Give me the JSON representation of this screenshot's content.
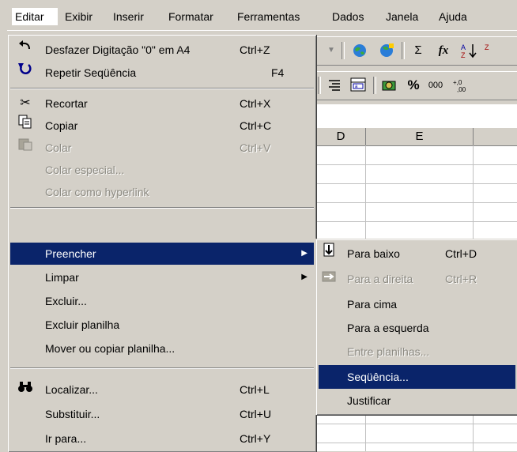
{
  "menubar": {
    "items": [
      "Editar",
      "Exibir",
      "Inserir",
      "Formatar",
      "Ferramentas",
      "Dados",
      "Janela",
      "Ajuda"
    ]
  },
  "toolbar1": {
    "buttons": [
      "Σ",
      "fx"
    ]
  },
  "toolbar2": {
    "buttons": [
      "%",
      "000"
    ]
  },
  "grid": {
    "col_d": "D",
    "col_e": "E"
  },
  "edit_menu": {
    "items": [
      {
        "label": "Desfazer Digitação \"0\" em A4",
        "shortcut": "Ctrl+Z",
        "icon": "undo-icon"
      },
      {
        "label": "Repetir Seqüência",
        "shortcut": "F4",
        "icon": "repeat-icon"
      },
      {
        "label": "Recortar",
        "shortcut": "Ctrl+X",
        "icon": "scissors-icon"
      },
      {
        "label": "Copiar",
        "shortcut": "Ctrl+C",
        "icon": "copy-icon"
      },
      {
        "label": "Colar",
        "shortcut": "Ctrl+V",
        "icon": "paste-icon"
      },
      {
        "label": "Colar especial...",
        "shortcut": ""
      },
      {
        "label": "Colar como hyperlink",
        "shortcut": ""
      },
      {
        "label": "Preencher",
        "shortcut": ""
      },
      {
        "label": "Limpar",
        "shortcut": ""
      },
      {
        "label": "Excluir...",
        "shortcut": ""
      },
      {
        "label": "Excluir planilha",
        "shortcut": ""
      },
      {
        "label": "Mover ou copiar planilha...",
        "shortcut": ""
      },
      {
        "label": "Localizar...",
        "shortcut": "Ctrl+L",
        "icon": "binoculars-icon"
      },
      {
        "label": "Substituir...",
        "shortcut": "Ctrl+U"
      },
      {
        "label": "Ir para...",
        "shortcut": "Ctrl+Y"
      }
    ]
  },
  "fill_submenu": {
    "items": [
      {
        "label": "Para baixo",
        "shortcut": "Ctrl+D",
        "icon": "fill-down-icon"
      },
      {
        "label": "Para a direita",
        "shortcut": "Ctrl+R",
        "icon": "fill-right-icon"
      },
      {
        "label": "Para cima",
        "shortcut": ""
      },
      {
        "label": "Para a esquerda",
        "shortcut": ""
      },
      {
        "label": "Entre planilhas...",
        "shortcut": ""
      },
      {
        "label": "Seqüência...",
        "shortcut": ""
      },
      {
        "label": "Justificar",
        "shortcut": ""
      }
    ]
  }
}
